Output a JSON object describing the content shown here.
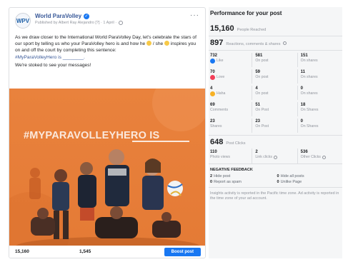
{
  "post": {
    "page_name": "World ParaVolley",
    "logo_text": "WPV",
    "meta": "Published by Albert Ray Alejandro [?] · 1 April ·",
    "body_line1": "As we draw closer to the International World ParaVolley Day, let's celebrate the stars of our sport by telling us who your ParaVolley hero is and how he",
    "body_line1b": "/ she",
    "body_line1c": "inspires you on and off the court by completing this sentence:",
    "hashtag_sentence": "#MyParaVolleyHero is ________.",
    "closing": "We're stoked to see your messages!",
    "image_hashtag": "#MYPARAVOLLEYHERO IS",
    "footer_stat_1": "15,160",
    "footer_stat_2": "1,545",
    "boost_label": "Boost post"
  },
  "insights": {
    "title": "Performance for your post",
    "reached": {
      "value": "15,160",
      "label": "People Reached"
    },
    "engagement": {
      "value": "897",
      "label": "Reactions, comments & shares"
    },
    "rows": [
      {
        "total": "732",
        "total_label": "Like",
        "icon": "like",
        "on_post": "581",
        "on_post_label": "On post",
        "on_shares": "151",
        "on_shares_label": "On shares"
      },
      {
        "total": "70",
        "total_label": "Love",
        "icon": "love",
        "on_post": "59",
        "on_post_label": "On post",
        "on_shares": "11",
        "on_shares_label": "On shares"
      },
      {
        "total": "4",
        "total_label": "Haha",
        "icon": "haha",
        "on_post": "4",
        "on_post_label": "On post",
        "on_shares": "0",
        "on_shares_label": "On shares"
      },
      {
        "total": "69",
        "total_label": "Comments",
        "icon": "",
        "on_post": "51",
        "on_post_label": "On Post",
        "on_shares": "18",
        "on_shares_label": "On Shares"
      },
      {
        "total": "23",
        "total_label": "Shares",
        "icon": "",
        "on_post": "23",
        "on_post_label": "On Post",
        "on_shares": "0",
        "on_shares_label": "On Shares"
      }
    ],
    "post_clicks": {
      "value": "648",
      "label": "Post Clicks"
    },
    "clicks": [
      {
        "value": "110",
        "label": "Photo views"
      },
      {
        "value": "2",
        "label": "Link clicks"
      },
      {
        "value": "536",
        "label": "Other Clicks"
      }
    ],
    "negative_title": "NEGATIVE FEEDBACK",
    "negative": [
      {
        "value": "2",
        "label": "Hide post"
      },
      {
        "value": "0",
        "label": "Hide all posts"
      },
      {
        "value": "0",
        "label": "Report as spam"
      },
      {
        "value": "0",
        "label": "Unlike Page"
      }
    ],
    "footnote": "Insights activity is reported in the Pacific time zone. Ad activity is reported in the time zone of your ad account."
  },
  "colors": {
    "facebook_blue": "#1877f2",
    "image_orange": "#e47a35",
    "panel_bg": "#f5f6f7"
  }
}
